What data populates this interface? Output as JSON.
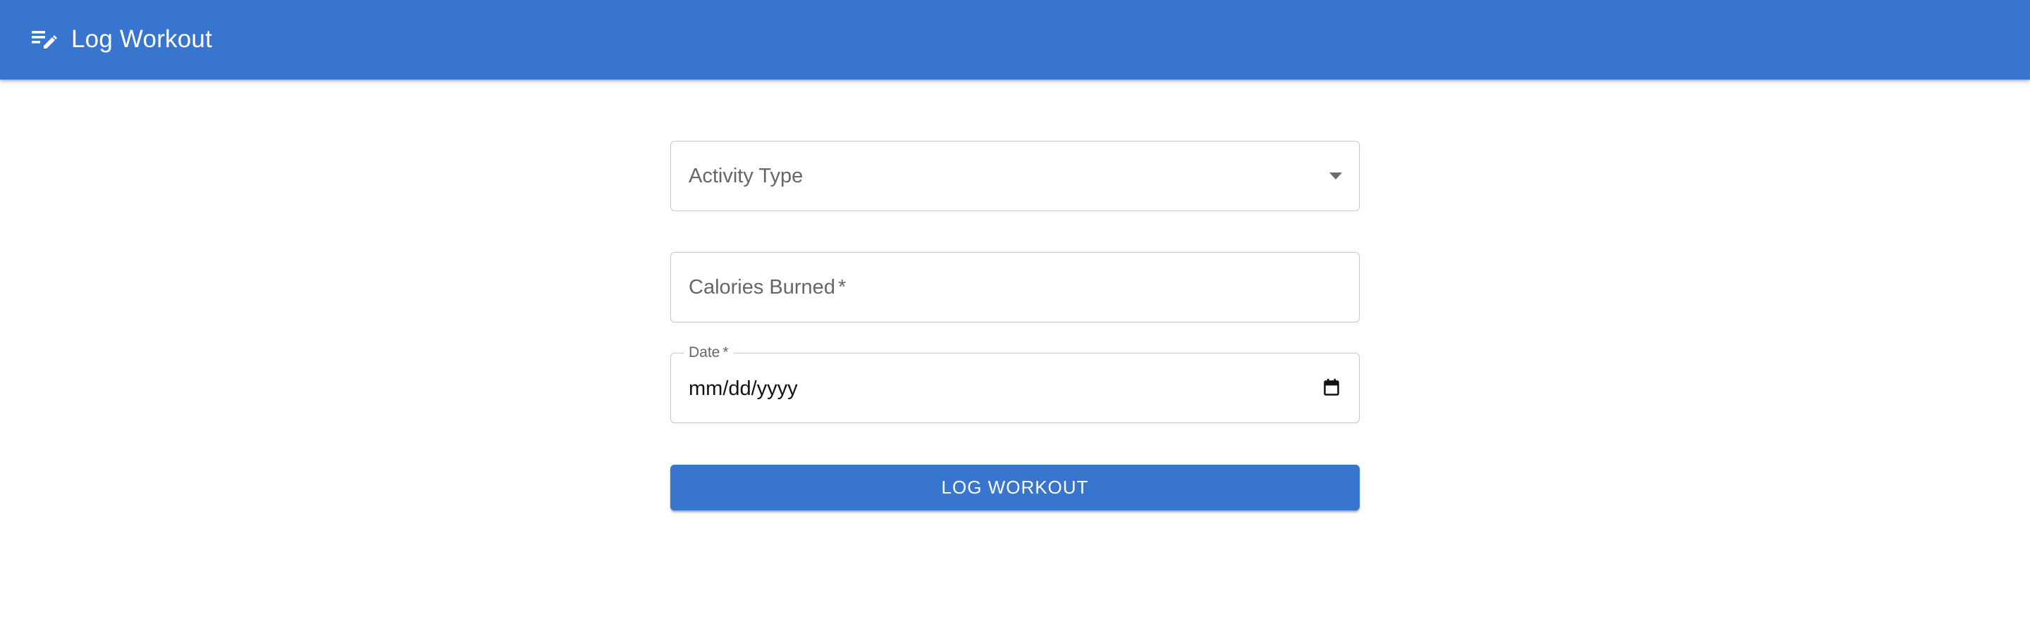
{
  "appbar": {
    "title": "Log Workout",
    "icon": "edit-list-icon",
    "color": "#3875cf"
  },
  "form": {
    "activity_type": {
      "label": "Activity Type",
      "icon": "dropdown-arrow-icon"
    },
    "calories": {
      "label": "Calories Burned",
      "required_mark": "*"
    },
    "date": {
      "label": "Date",
      "required_mark": "*",
      "value": "mm/dd/yyyy",
      "icon": "calendar-icon"
    },
    "submit_label": "LOG WORKOUT"
  }
}
